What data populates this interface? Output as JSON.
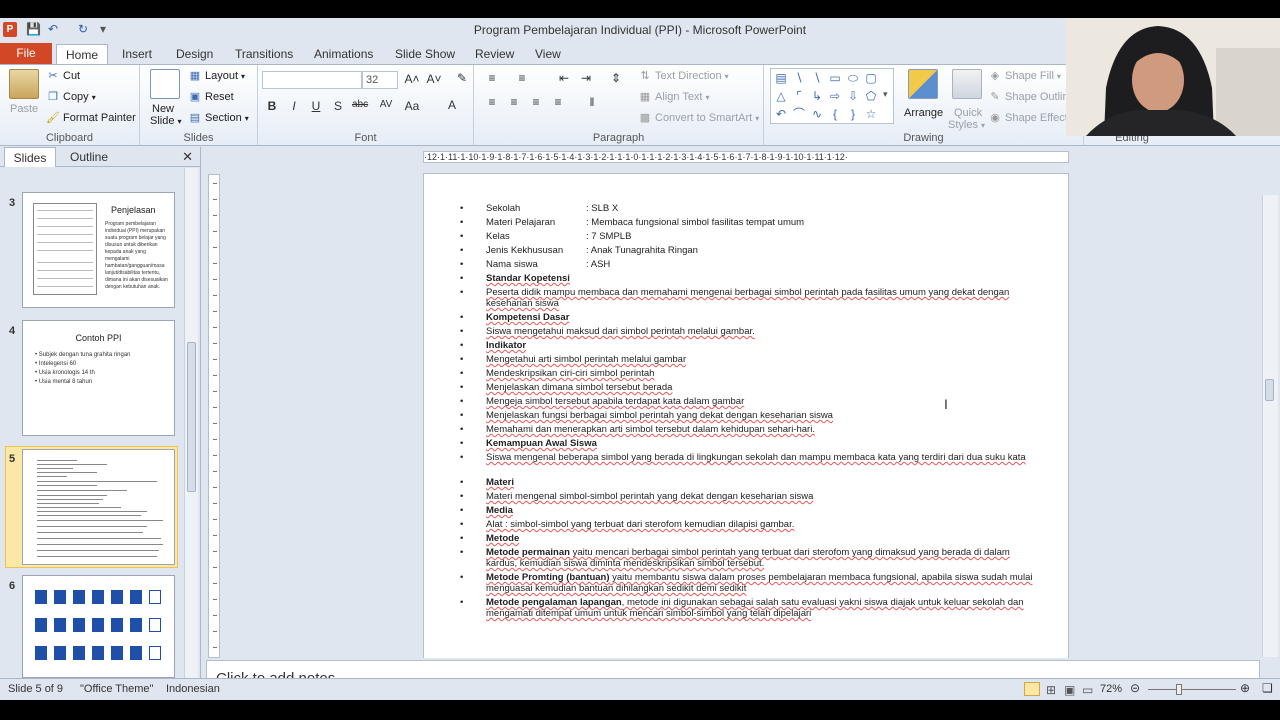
{
  "window": {
    "title": "Program Pembelajaran Individual (PPI)  -  Microsoft PowerPoint"
  },
  "tabs": [
    "File",
    "Home",
    "Insert",
    "Design",
    "Transitions",
    "Animations",
    "Slide Show",
    "Review",
    "View"
  ],
  "ribbon": {
    "clipboard": {
      "label": "Clipboard",
      "paste": "Paste",
      "cut": "Cut",
      "copy": "Copy",
      "format_painter": "Format Painter"
    },
    "slides": {
      "label": "Slides",
      "new_slide_1": "New",
      "new_slide_2": "Slide",
      "layout": "Layout",
      "reset": "Reset",
      "section": "Section"
    },
    "font": {
      "label": "Font",
      "size": "32"
    },
    "paragraph": {
      "label": "Paragraph",
      "text_direction": "Text Direction",
      "align_text": "Align Text",
      "convert_smartart": "Convert to SmartArt"
    },
    "drawing": {
      "label": "Drawing",
      "arrange": "Arrange",
      "quick_styles_1": "Quick",
      "quick_styles_2": "Styles",
      "shape_fill": "Shape Fill",
      "shape_outline": "Shape Outline",
      "shape_effects": "Shape Effects"
    },
    "editing": {
      "label": "Editing"
    }
  },
  "left_pane": {
    "tab_slides": "Slides",
    "tab_outline": "Outline",
    "thumbnails": [
      {
        "number": "3",
        "title": "Penjelasan",
        "text": "Program pembelajaran individual (PPI) merupakan suatu program belajar yang disusun untuk diberikan kepada anak yang mengalami hambatan/gangguan/masa lanjut/disabilitas tertentu, dimana ini akan disesuaikan dengan kebutuhan anak."
      },
      {
        "number": "4",
        "title": "Contoh PPI",
        "items": [
          "Subjek dengan tuna grahita ringan",
          "Intelegensi 60",
          "Usia kronologis 14 th",
          "Usia mental 8 tahun"
        ]
      },
      {
        "number": "5"
      },
      {
        "number": "6"
      }
    ]
  },
  "slide": {
    "bullets": [
      {
        "html_label": "Sekolah",
        "value": ": SLB X"
      },
      {
        "html_label": "Materi Pelajaran",
        "value": ": Membaca fungsional simbol fasilitas tempat umum"
      },
      {
        "html_label": "Kelas",
        "value": ": 7 SMPLB"
      },
      {
        "html_label": "Jenis Kekhususan",
        "value": ": Anak Tunagrahita Ringan"
      },
      {
        "html_label": "Nama siswa",
        "value": ": ASH"
      }
    ],
    "standar_kompetensi": "Standar  Kopetensi",
    "sk_text": "Peserta didik mampu membaca dan memahami mengenai berbagai simbol perintah pada fasilitas umum yang dekat dengan keseharian siswa",
    "kompetensi_dasar": "Kompetensi  Dasar",
    "kd_text": "Siswa mengetahui maksud dari simbol perintah melalui gambar.",
    "indikator": "Indikator",
    "indikator_items": [
      "Mengetahui arti simbol perintah melalui gambar",
      "Mendeskripsikan ciri-ciri simbol perintah",
      "Menjelaskan dimana simbol tersebut berada",
      "Mengeja simbol tersebut apabila terdapat kata dalam gambar",
      "Menjelaskan fungsi berbagai simbol perintah yang dekat dengan keseharian siswa",
      "Memahami dan menerapkan arti simbol tersebut dalam kehidupan sehari-hari."
    ],
    "kemampuan_awal": "Kemampuan  Awal  Siswa",
    "ka_text": "Siswa mengenal beberapa simbol yang berada di lingkungan sekolah dan mampu membaca kata yang terdiri dari dua suku kata",
    "materi": "Materi",
    "materi_text": "Materi mengenal simbol-simbol perintah yang dekat dengan keseharian siswa",
    "media": "Media",
    "media_text": "Alat : simbol-simbol yang terbuat dari sterofom kemudian dilapisi gambar.",
    "metode": "Metode",
    "metode_1_label": "Metode  permainan",
    "metode_1_text": "  yaitu mencari berbagai simbol perintah yang terbuat dari sterofom yang dimaksud yang berada di dalam kardus, kemudian siswa diminta mendeskripsikan simbol tersebut.",
    "metode_2_label": "Metode  Promting  (bantuan)",
    "metode_2_text": "  yaitu membantu siswa dalam proses pembelajaran membaca fungsional, apabila siswa sudah mulai menguasai kemudian bantuan dihilangkan sedikit demi sedikit",
    "metode_3_label": "Metode  pengalaman  lapangan",
    "metode_3_text": ",  metode ini digunakan sebagai salah satu evaluasi yakni siswa diajak untuk keluar sekolah dan mengamati ditempat umum untuk mencari simbol-simbol yang telah dipelajari",
    "ruler_text": "·12·1·11·1·10·1·9·1·8·1·7·1·6·1·5·1·4·1·3·1·2·1·1·1·0·1·1·1·2·1·3·1·4·1·5·1·6·1·7·1·8·1·9·1·10·1·11·1·12·"
  },
  "notes_placeholder": "Click to add notes",
  "status": {
    "slide_info": "Slide 5 of 9",
    "theme": "\"Office Theme\"",
    "language": "Indonesian",
    "zoom": "72%"
  },
  "colors": {
    "file_tab": "#d24726",
    "selected_thumb": "#fbe7a6",
    "ribbon_bg": "#dfe6ef"
  }
}
